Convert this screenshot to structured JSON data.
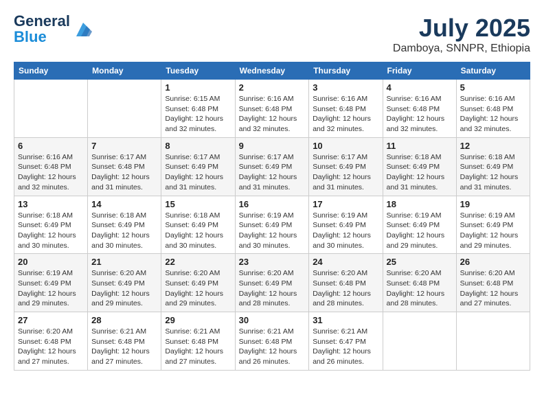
{
  "header": {
    "logo_line1": "General",
    "logo_line2": "Blue",
    "month": "July 2025",
    "location": "Damboya, SNNPR, Ethiopia"
  },
  "weekdays": [
    "Sunday",
    "Monday",
    "Tuesday",
    "Wednesday",
    "Thursday",
    "Friday",
    "Saturday"
  ],
  "weeks": [
    [
      {
        "day": "",
        "content": ""
      },
      {
        "day": "",
        "content": ""
      },
      {
        "day": "1",
        "content": "Sunrise: 6:15 AM\nSunset: 6:48 PM\nDaylight: 12 hours and 32 minutes."
      },
      {
        "day": "2",
        "content": "Sunrise: 6:16 AM\nSunset: 6:48 PM\nDaylight: 12 hours and 32 minutes."
      },
      {
        "day": "3",
        "content": "Sunrise: 6:16 AM\nSunset: 6:48 PM\nDaylight: 12 hours and 32 minutes."
      },
      {
        "day": "4",
        "content": "Sunrise: 6:16 AM\nSunset: 6:48 PM\nDaylight: 12 hours and 32 minutes."
      },
      {
        "day": "5",
        "content": "Sunrise: 6:16 AM\nSunset: 6:48 PM\nDaylight: 12 hours and 32 minutes."
      }
    ],
    [
      {
        "day": "6",
        "content": "Sunrise: 6:16 AM\nSunset: 6:48 PM\nDaylight: 12 hours and 32 minutes."
      },
      {
        "day": "7",
        "content": "Sunrise: 6:17 AM\nSunset: 6:48 PM\nDaylight: 12 hours and 31 minutes."
      },
      {
        "day": "8",
        "content": "Sunrise: 6:17 AM\nSunset: 6:49 PM\nDaylight: 12 hours and 31 minutes."
      },
      {
        "day": "9",
        "content": "Sunrise: 6:17 AM\nSunset: 6:49 PM\nDaylight: 12 hours and 31 minutes."
      },
      {
        "day": "10",
        "content": "Sunrise: 6:17 AM\nSunset: 6:49 PM\nDaylight: 12 hours and 31 minutes."
      },
      {
        "day": "11",
        "content": "Sunrise: 6:18 AM\nSunset: 6:49 PM\nDaylight: 12 hours and 31 minutes."
      },
      {
        "day": "12",
        "content": "Sunrise: 6:18 AM\nSunset: 6:49 PM\nDaylight: 12 hours and 31 minutes."
      }
    ],
    [
      {
        "day": "13",
        "content": "Sunrise: 6:18 AM\nSunset: 6:49 PM\nDaylight: 12 hours and 30 minutes."
      },
      {
        "day": "14",
        "content": "Sunrise: 6:18 AM\nSunset: 6:49 PM\nDaylight: 12 hours and 30 minutes."
      },
      {
        "day": "15",
        "content": "Sunrise: 6:18 AM\nSunset: 6:49 PM\nDaylight: 12 hours and 30 minutes."
      },
      {
        "day": "16",
        "content": "Sunrise: 6:19 AM\nSunset: 6:49 PM\nDaylight: 12 hours and 30 minutes."
      },
      {
        "day": "17",
        "content": "Sunrise: 6:19 AM\nSunset: 6:49 PM\nDaylight: 12 hours and 30 minutes."
      },
      {
        "day": "18",
        "content": "Sunrise: 6:19 AM\nSunset: 6:49 PM\nDaylight: 12 hours and 29 minutes."
      },
      {
        "day": "19",
        "content": "Sunrise: 6:19 AM\nSunset: 6:49 PM\nDaylight: 12 hours and 29 minutes."
      }
    ],
    [
      {
        "day": "20",
        "content": "Sunrise: 6:19 AM\nSunset: 6:49 PM\nDaylight: 12 hours and 29 minutes."
      },
      {
        "day": "21",
        "content": "Sunrise: 6:20 AM\nSunset: 6:49 PM\nDaylight: 12 hours and 29 minutes."
      },
      {
        "day": "22",
        "content": "Sunrise: 6:20 AM\nSunset: 6:49 PM\nDaylight: 12 hours and 29 minutes."
      },
      {
        "day": "23",
        "content": "Sunrise: 6:20 AM\nSunset: 6:49 PM\nDaylight: 12 hours and 28 minutes."
      },
      {
        "day": "24",
        "content": "Sunrise: 6:20 AM\nSunset: 6:48 PM\nDaylight: 12 hours and 28 minutes."
      },
      {
        "day": "25",
        "content": "Sunrise: 6:20 AM\nSunset: 6:48 PM\nDaylight: 12 hours and 28 minutes."
      },
      {
        "day": "26",
        "content": "Sunrise: 6:20 AM\nSunset: 6:48 PM\nDaylight: 12 hours and 27 minutes."
      }
    ],
    [
      {
        "day": "27",
        "content": "Sunrise: 6:20 AM\nSunset: 6:48 PM\nDaylight: 12 hours and 27 minutes."
      },
      {
        "day": "28",
        "content": "Sunrise: 6:21 AM\nSunset: 6:48 PM\nDaylight: 12 hours and 27 minutes."
      },
      {
        "day": "29",
        "content": "Sunrise: 6:21 AM\nSunset: 6:48 PM\nDaylight: 12 hours and 27 minutes."
      },
      {
        "day": "30",
        "content": "Sunrise: 6:21 AM\nSunset: 6:48 PM\nDaylight: 12 hours and 26 minutes."
      },
      {
        "day": "31",
        "content": "Sunrise: 6:21 AM\nSunset: 6:47 PM\nDaylight: 12 hours and 26 minutes."
      },
      {
        "day": "",
        "content": ""
      },
      {
        "day": "",
        "content": ""
      }
    ]
  ]
}
